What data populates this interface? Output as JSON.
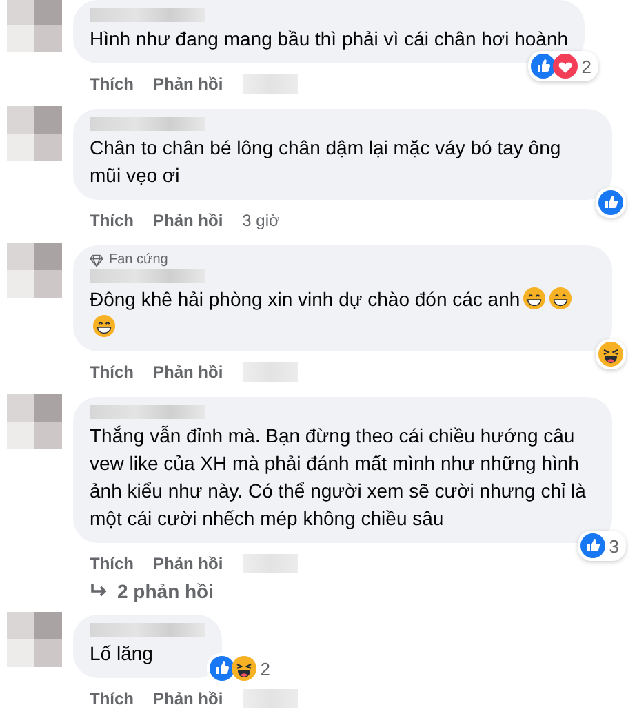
{
  "comments": [
    {
      "text": "Hình như đang mang bầu thì phải vì cái chân hơi hoành",
      "reactions": [
        {
          "kind": "like"
        },
        {
          "kind": "love"
        }
      ],
      "reaction_count": "2",
      "actions": [
        "Thích",
        "Phản hồi"
      ]
    },
    {
      "text": "Chân to chân bé lông chân dậm lại mặc váy bó tay ông mũi vẹo ơi",
      "reactions": [
        {
          "kind": "like"
        }
      ],
      "actions": [
        "Thích",
        "Phản hồi"
      ],
      "time": "3 giờ"
    },
    {
      "badge": "Fan cứng",
      "text": "Đông khê hải phòng xin vinh dự chào đón các anh",
      "emojis": [
        {
          "kind": "grin"
        },
        {
          "kind": "grin"
        },
        {
          "kind": "grin"
        }
      ],
      "reactions": [
        {
          "kind": "haha"
        }
      ],
      "actions": [
        "Thích",
        "Phản hồi"
      ]
    },
    {
      "text": "Thắng vẫn đỉnh mà. Bạn đừng theo cái chiều hướng câu vew like của XH mà phải đánh mất mình như những hình ảnh kiểu như này. Có thể người xem sẽ cười nhưng chỉ là một cái cười nhếch mép không chiều sâu",
      "reactions": [
        {
          "kind": "like"
        }
      ],
      "reaction_count": "3",
      "actions": [
        "Thích",
        "Phản hồi"
      ],
      "replies": "2 phản hồi"
    },
    {
      "text": "Lố lăng",
      "reactions": [
        {
          "kind": "like"
        },
        {
          "kind": "haha"
        }
      ],
      "reaction_count": "2",
      "actions": [
        "Thích",
        "Phản hồi"
      ],
      "inline_reactions": true
    }
  ]
}
